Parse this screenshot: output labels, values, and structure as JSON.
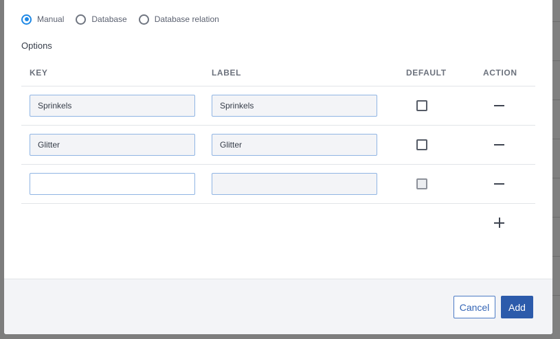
{
  "source_options": {
    "items": [
      {
        "label": "Manual",
        "selected": true
      },
      {
        "label": "Database",
        "selected": false
      },
      {
        "label": "Database relation",
        "selected": false
      }
    ]
  },
  "options_title": "Options",
  "table": {
    "headers": {
      "key": "KEY",
      "label": "LABEL",
      "default": "DEFAULT",
      "action": "ACTION"
    },
    "rows": [
      {
        "key": "Sprinkels",
        "label": "Sprinkels",
        "default": false
      },
      {
        "key": "Glitter",
        "label": "Glitter",
        "default": false
      },
      {
        "key": "",
        "label": "",
        "default": false
      }
    ]
  },
  "footer": {
    "cancel_label": "Cancel",
    "add_label": "Add"
  },
  "colors": {
    "primary": "#2c5bab",
    "radio_accent": "#1e88e5",
    "footer_bg": "#f3f4f7"
  }
}
